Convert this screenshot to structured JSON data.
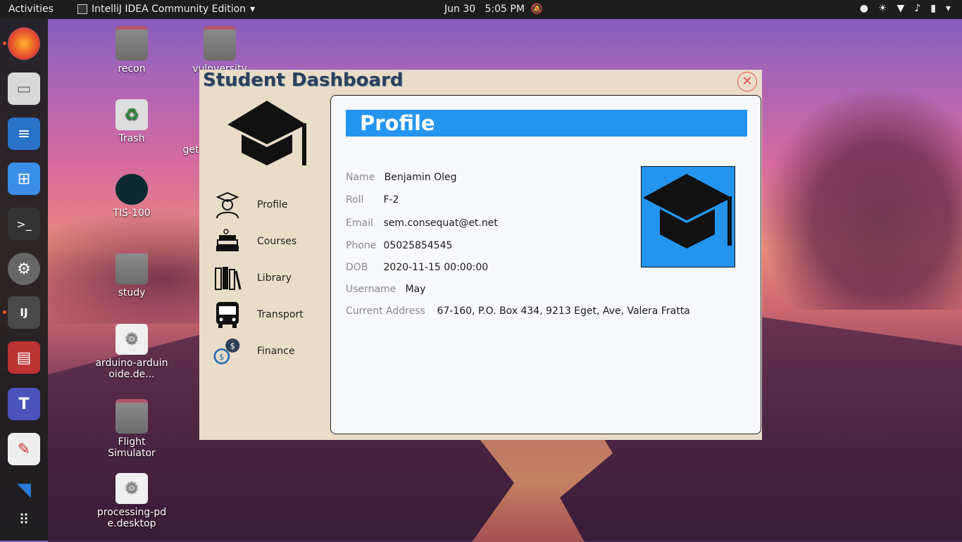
{
  "topbar": {
    "activities": "Activities",
    "app_name": "IntelliJ IDEA Community Edition",
    "date": "Jun 30",
    "time": "5:05 PM"
  },
  "desktop_icons": [
    {
      "label": "recon"
    },
    {
      "label": "vulnversity"
    },
    {
      "label": "Trash"
    },
    {
      "label": "get"
    },
    {
      "label": "TIS-100"
    },
    {
      "label": "study"
    },
    {
      "label": "arduino-arduinoide.de..."
    },
    {
      "label": "Flight Simulator"
    },
    {
      "label": "processing-pde.desktop"
    }
  ],
  "window": {
    "title": "Student Dashboard",
    "close_symbol": "✕",
    "nav": [
      {
        "label": "Profile",
        "icon": "student-icon"
      },
      {
        "label": "Courses",
        "icon": "books-icon"
      },
      {
        "label": "Library",
        "icon": "library-icon"
      },
      {
        "label": "Transport",
        "icon": "bus-icon"
      },
      {
        "label": "Finance",
        "icon": "finance-icon"
      }
    ],
    "panel": {
      "heading": "Profile",
      "fields": {
        "name_label": "Name",
        "name": "Benjamin Oleg",
        "roll_label": "Roll",
        "roll": "F-2",
        "email_label": "Email",
        "email": "sem.consequat@et.net",
        "phone_label": "Phone",
        "phone": "05025854545",
        "dob_label": "DOB",
        "dob": "2020-11-15 00:00:00",
        "username_label": "Username",
        "username": "May",
        "address_label": "Current Address",
        "address": "67-160, P.O. Box 434, 9213 Eget, Ave, Valera Fratta"
      }
    }
  },
  "colors": {
    "accent": "#2495ef",
    "window_bg": "#e9dcc8",
    "close": "#e55555"
  }
}
